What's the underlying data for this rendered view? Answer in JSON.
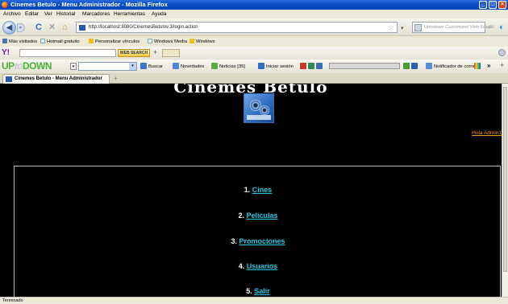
{
  "window": {
    "title": "Cinemes Betulo - Menu Administrador - Mozilla Firefox"
  },
  "menubar": [
    "Archivo",
    "Editar",
    "Ver",
    "Historial",
    "Marcadores",
    "Herramientas",
    "Ayuda"
  ],
  "navbar": {
    "url": "http://localhost:8080/CinemesBetulov.3/login.action",
    "search_placeholder": "Uptodown Customized Web Search"
  },
  "bookmarks": [
    "Más visitados",
    "Hotmail gratuito",
    "Personalizar vínculos",
    "Windows Media",
    "Windows"
  ],
  "yahoo_toolbar": {
    "logo": "Y!",
    "web_search": "WEB SEARCH"
  },
  "uptodown_toolbar": {
    "logo_up": "UP",
    "logo_to": "to",
    "logo_down": "DOWN",
    "buscar": "Buscar",
    "novedades": "Novedades",
    "noticias": "Noticias [35]",
    "iniciar_sesion": "Iniciar sesión",
    "notificador": "Notificador de correo"
  },
  "tab": {
    "label": "Cinemes Betulo - Menu Administrador"
  },
  "page": {
    "site_title": "Cinemes Betulo",
    "greeting": "Hola Admin1",
    "menu": [
      {
        "number": "1.",
        "label": "Cines"
      },
      {
        "number": "2.",
        "label": "Peliculas"
      },
      {
        "number": "3.",
        "label": "Promociones"
      },
      {
        "number": "4.",
        "label": "Usuarios"
      },
      {
        "number": "5.",
        "label": "Salir"
      }
    ]
  },
  "status": {
    "text": "Terminado"
  },
  "colors": {
    "page_bg": "#000000",
    "link": "#26c6e6",
    "greeting": "#f29a1b",
    "titlebar": "#0a4fc9"
  }
}
